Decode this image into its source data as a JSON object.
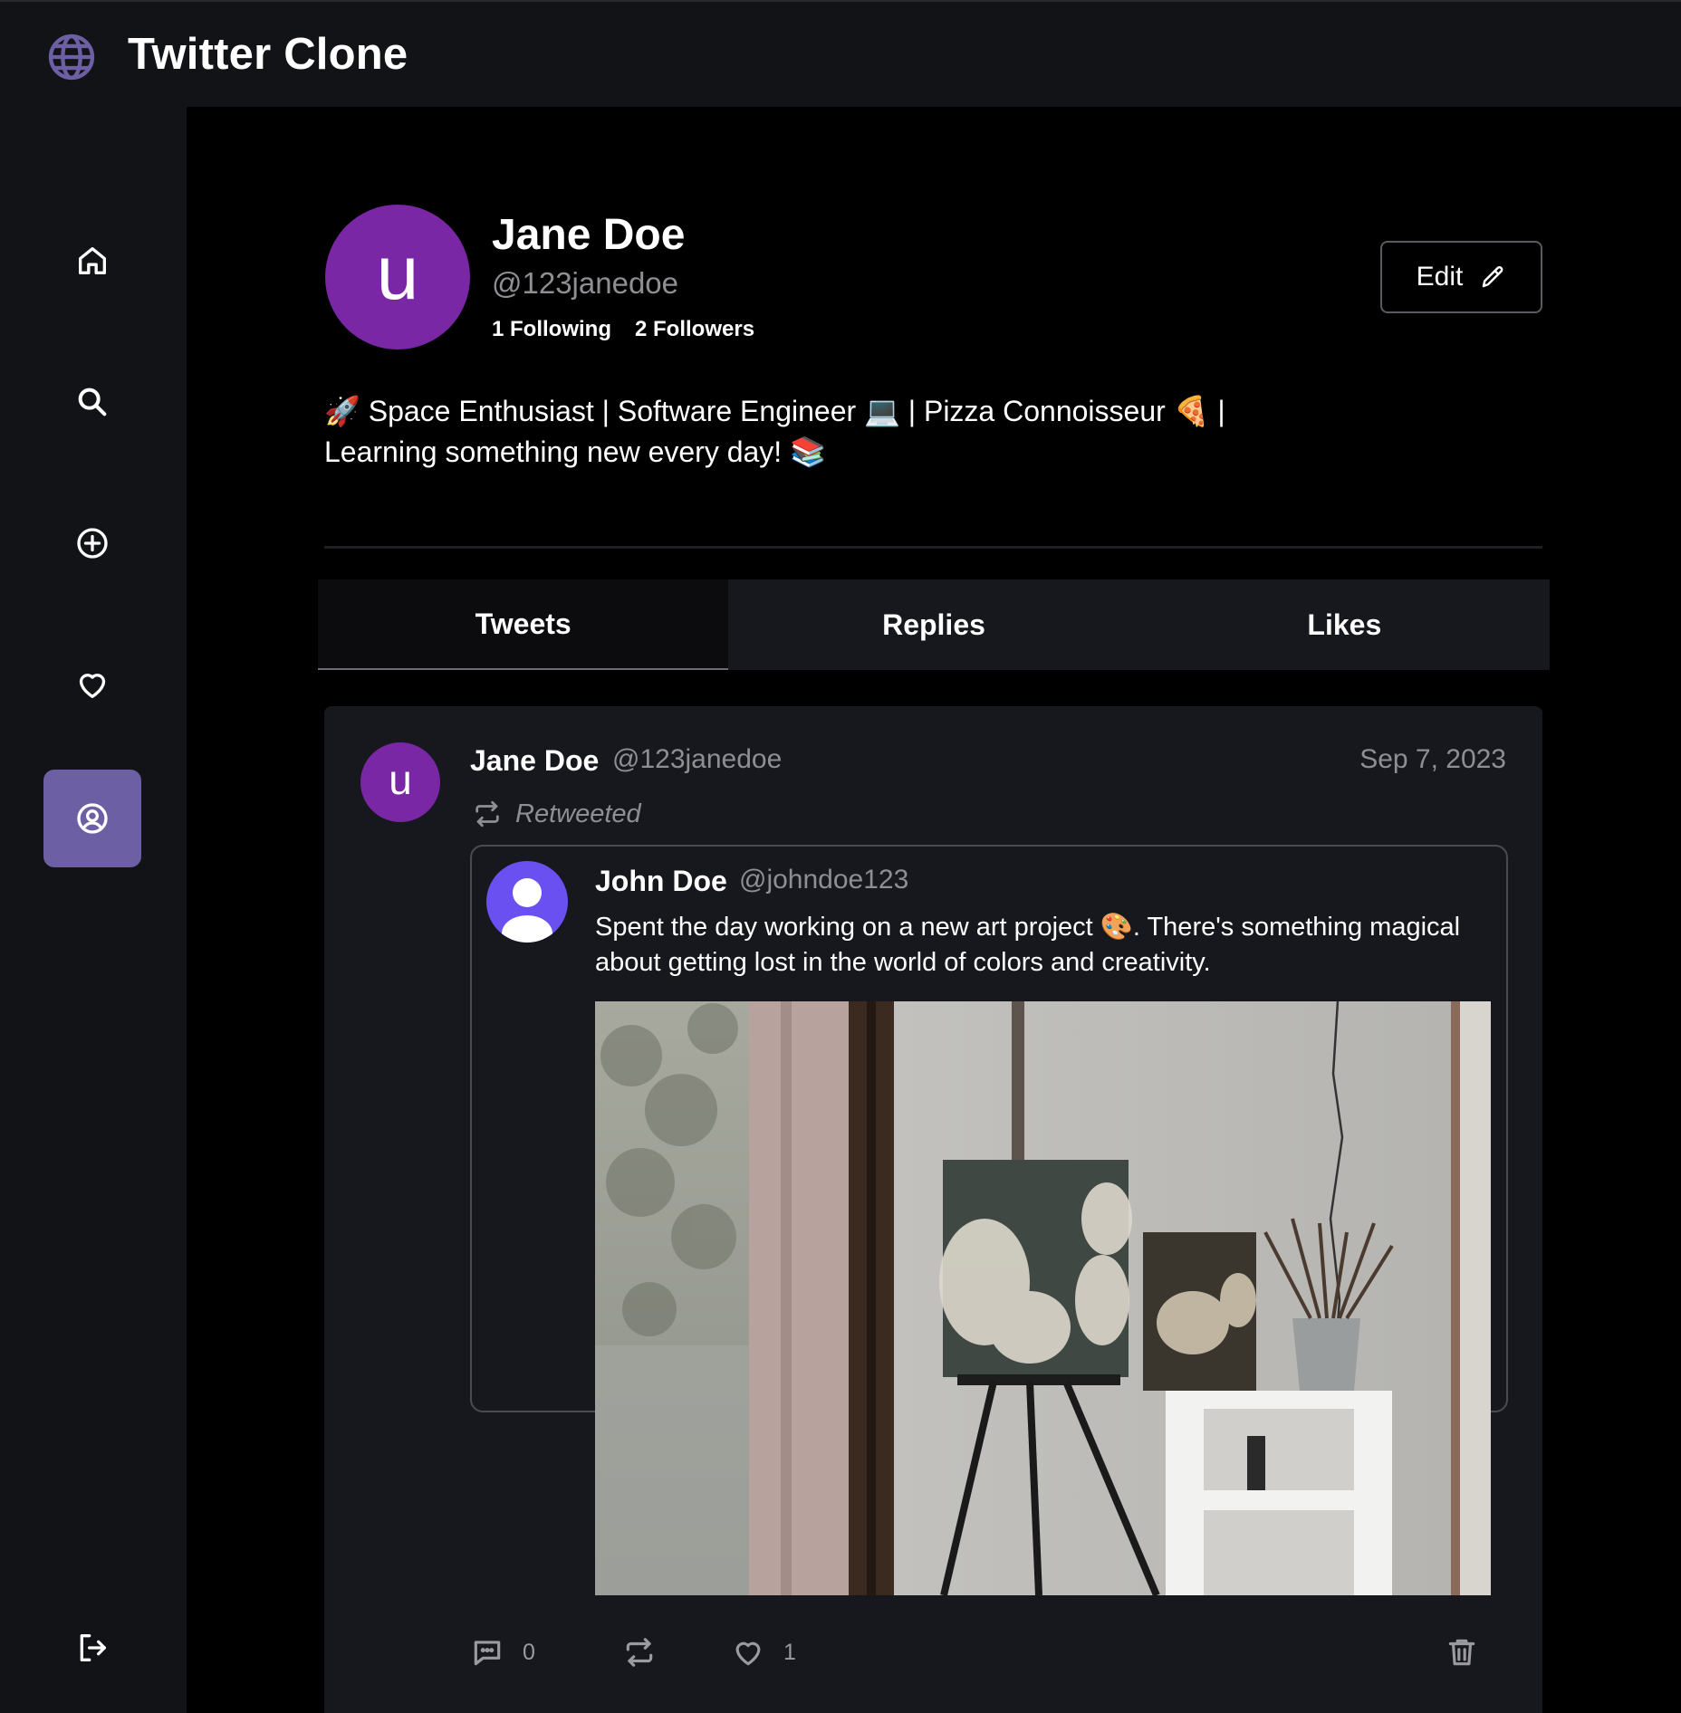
{
  "app": {
    "title": "Twitter Clone",
    "logo_icon": "globe-icon"
  },
  "sidebar": {
    "items": [
      {
        "name": "home",
        "icon": "home-icon",
        "active": false
      },
      {
        "name": "search",
        "icon": "search-icon",
        "active": false
      },
      {
        "name": "create",
        "icon": "plus-circle-icon",
        "active": false
      },
      {
        "name": "likes",
        "icon": "heart-icon",
        "active": false
      },
      {
        "name": "profile",
        "icon": "user-circle-icon",
        "active": true
      }
    ],
    "logout_icon": "logout-icon",
    "active_color": "#6d5fa3"
  },
  "profile": {
    "avatar_letter": "u",
    "avatar_color": "#7a27a6",
    "name": "Jane Doe",
    "handle": "@123janedoe",
    "following": "1 Following",
    "followers": "2 Followers",
    "edit_label": "Edit",
    "bio_line1": "🚀 Space Enthusiast | Software Engineer 💻 | Pizza Connoisseur 🍕 |",
    "bio_line2": "Learning something new every day! 📚"
  },
  "tabs": [
    {
      "label": "Tweets",
      "active": true
    },
    {
      "label": "Replies",
      "active": false
    },
    {
      "label": "Likes",
      "active": false
    }
  ],
  "tweet": {
    "avatar_letter": "u",
    "author": "Jane Doe",
    "handle": "@123janedoe",
    "date": "Sep 7, 2023",
    "retweet_label": "Retweeted",
    "quoted": {
      "author": "John Doe",
      "handle": "@johndoe123",
      "text": "Spent the day working on a new art project 🎨. There's something magical about getting lost in the world of colors and creativity.",
      "image_description_icon": "easel-painting-image"
    },
    "actions": {
      "comments": "0",
      "likes": "1"
    }
  }
}
